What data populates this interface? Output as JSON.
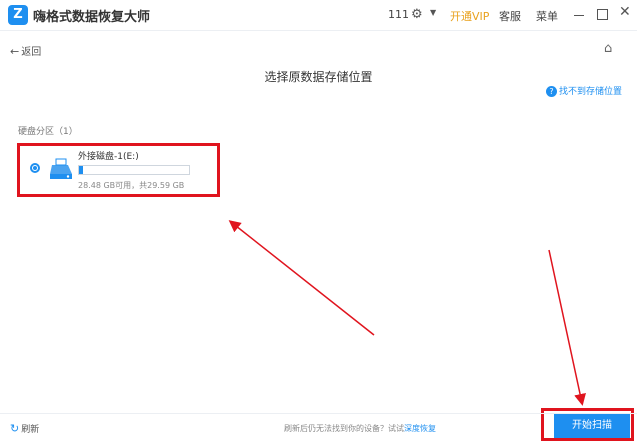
{
  "window": {
    "title": "嗨格式数据恢复大师",
    "count": "111",
    "vip": "开通VIP",
    "service": "客服",
    "menu": "菜单",
    "logo_letter": "Z"
  },
  "nav": {
    "back": "返回"
  },
  "main": {
    "title": "选择原数据存储位置",
    "help": "找不到存储位置"
  },
  "disks": {
    "section_label": "硬盘分区（1）",
    "items": [
      {
        "name": "外接磁盘-1(E:)",
        "size": "28.48 GB可用，共29.59 GB",
        "used_fraction": 0.04
      }
    ]
  },
  "footer": {
    "refresh": "刷新",
    "hint": "刷新后仍无法找到你的设备？试试",
    "hint_link": "深度恢复",
    "scan_button": "开始扫描"
  },
  "colors": {
    "accent": "#1e8ff0",
    "vip": "#e9a21f",
    "annotation": "#e0141e"
  },
  "icons": {
    "logo": "app-logo-icon",
    "gear": "gear-icon",
    "caret": "chevron-down-icon",
    "minimize": "minimize-icon",
    "maximize": "maximize-icon",
    "close": "close-icon",
    "back": "arrow-left-icon",
    "home": "home-icon",
    "help": "question-icon",
    "drive": "usb-drive-icon",
    "refresh": "refresh-icon"
  }
}
